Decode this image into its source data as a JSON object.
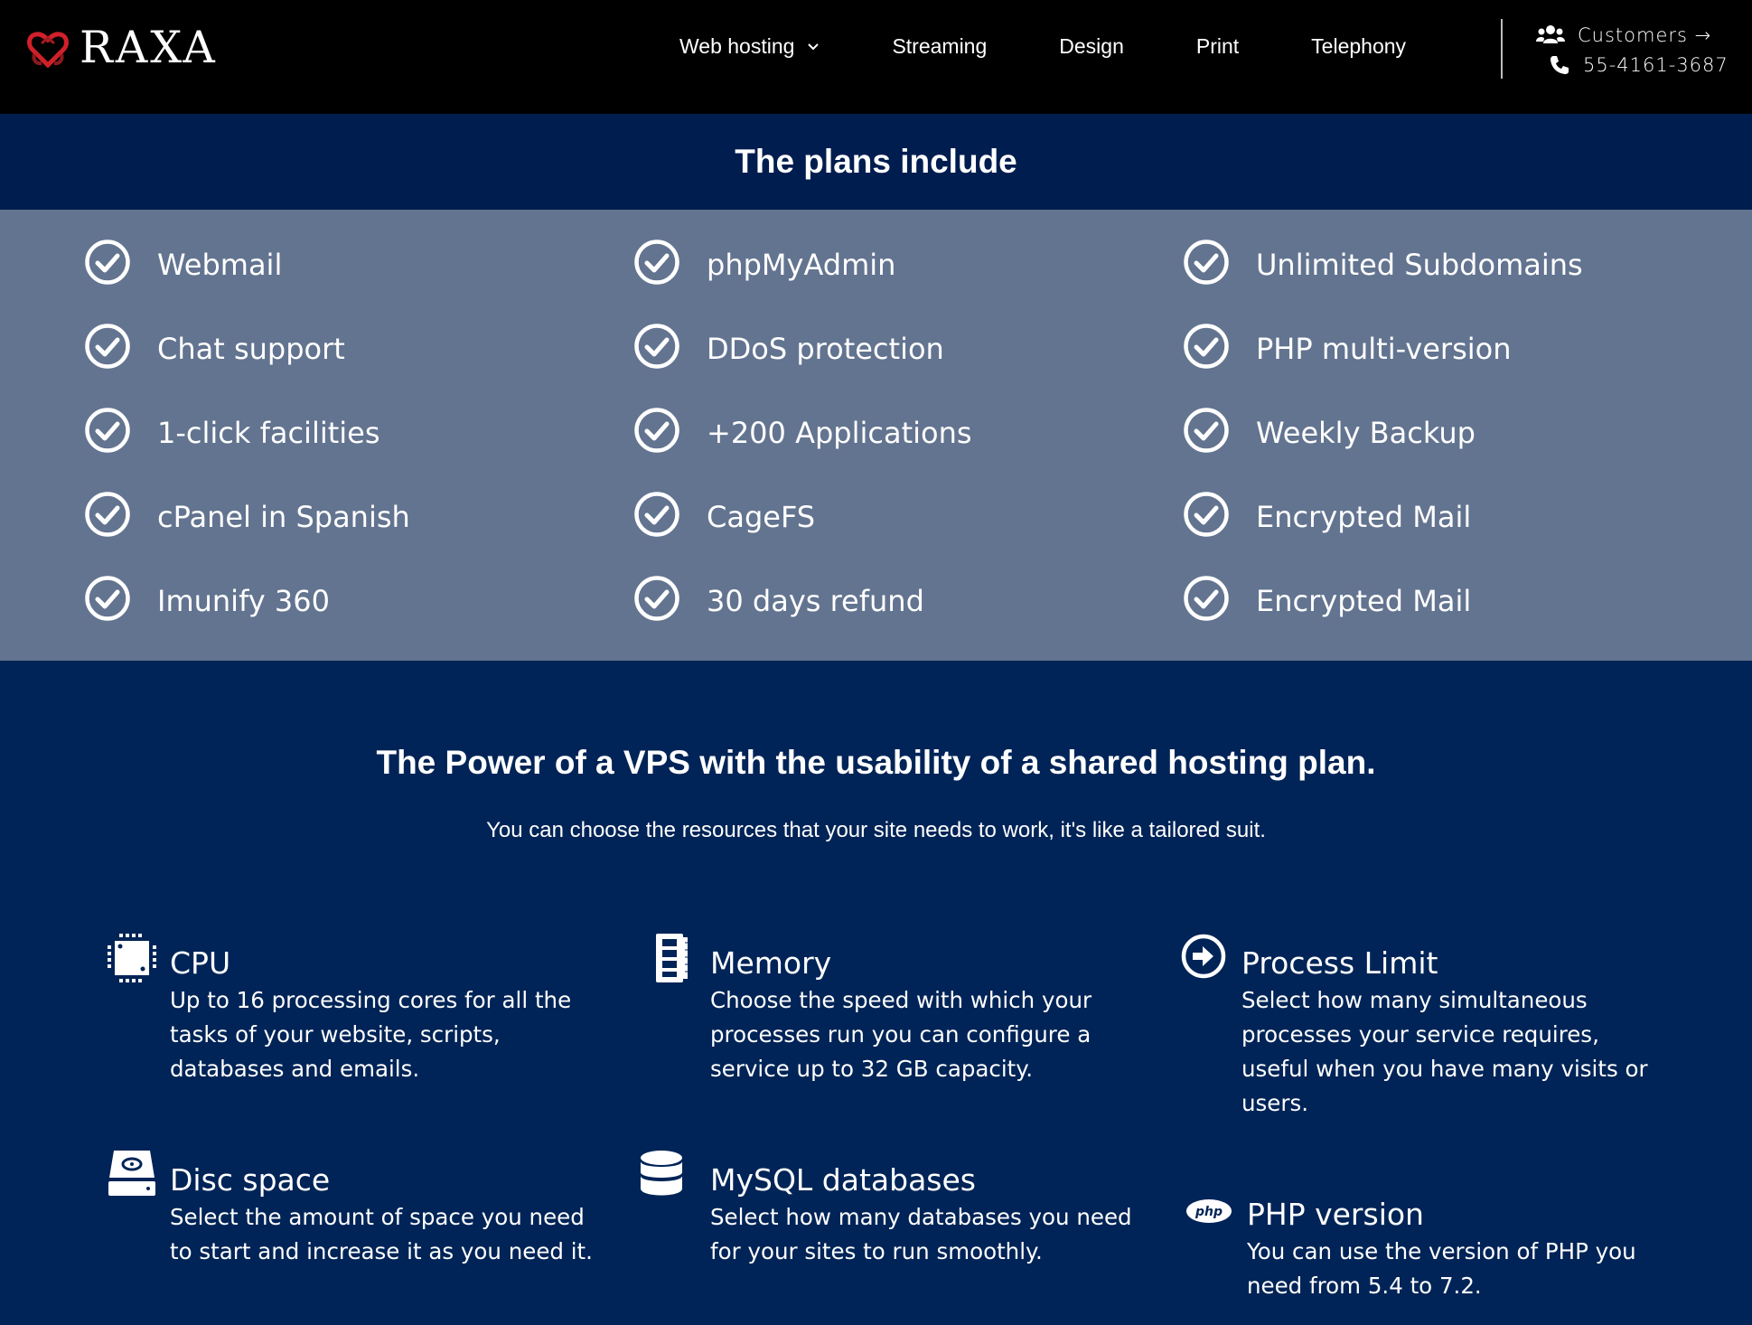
{
  "header": {
    "brand": "RAXA",
    "nav": [
      {
        "label": "Web hosting",
        "has_dropdown": true
      },
      {
        "label": "Streaming"
      },
      {
        "label": "Design"
      },
      {
        "label": "Print"
      },
      {
        "label": "Telephony"
      }
    ],
    "customers_label": "Customers →",
    "phone": "55-4161-3687"
  },
  "plans": {
    "title": "The plans include",
    "columns": [
      [
        "Webmail",
        "Chat support",
        "1-click facilities",
        "cPanel in Spanish",
        "Imunify 360"
      ],
      [
        "phpMyAdmin",
        "DDoS protection",
        "+200 Applications",
        "CageFS",
        "30 days refund"
      ],
      [
        "Unlimited Subdomains",
        "PHP multi-version",
        "Weekly Backup",
        "Encrypted Mail",
        "Encrypted Mail"
      ]
    ]
  },
  "power": {
    "title": "The Power of a VPS with the usability of a shared hosting plan.",
    "subtitle": "You can choose the resources that your site needs to work, it's like a tailored suit.",
    "resources": [
      {
        "icon": "cpu-icon",
        "title": "CPU",
        "desc": [
          "Up to 16 processing cores for all the",
          "tasks of your website, scripts,",
          "databases and emails."
        ]
      },
      {
        "icon": "memory-icon",
        "title": "Memory",
        "desc": [
          "Choose the speed with which your",
          "processes run you can configure a",
          "service up to 32 GB capacity."
        ]
      },
      {
        "icon": "process-arrow-icon",
        "title": "Process Limit",
        "desc": [
          "Select how many simultaneous",
          "processes your service requires,",
          "useful when you have many visits or",
          "users."
        ]
      },
      {
        "icon": "hard-disk-icon",
        "title": "Disc space",
        "desc": [
          "Select the amount of space you need",
          "to start and increase it as you need it."
        ]
      },
      {
        "icon": "database-icon",
        "title": "MySQL databases",
        "desc": [
          "Select how many databases you need",
          "for your sites to run smoothly."
        ]
      },
      {
        "icon": "php-logo-icon",
        "title": "PHP version",
        "desc": [
          "You can use the version of PHP you",
          "need from 5.4 to 7.2."
        ]
      }
    ]
  },
  "colors": {
    "header_bg": "#000000",
    "title_band_bg": "#001d4f",
    "plans_bg": "#637490",
    "section_bg": "#002457",
    "logo_red": "#d0202a"
  }
}
